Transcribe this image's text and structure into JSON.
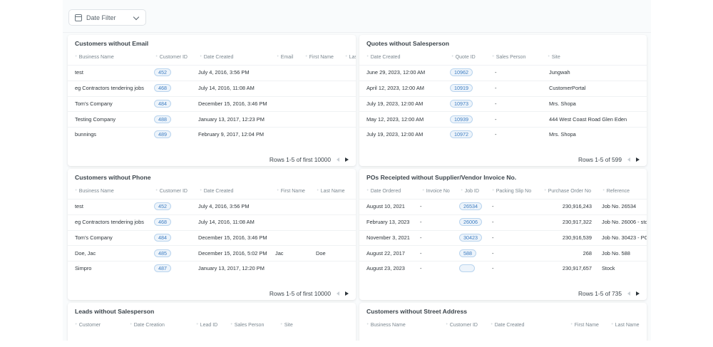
{
  "filter": {
    "label": "Date Filter"
  },
  "cards": {
    "c1": {
      "title": "Customers without Email",
      "headers": [
        "Business Name",
        "Customer ID",
        "Date Created",
        "Email",
        "First Name",
        "Las"
      ],
      "rows": [
        [
          "test",
          "452",
          "July 4, 2016, 3:56 PM",
          "",
          "",
          ""
        ],
        [
          "eg Contractors tendering jobs",
          "468",
          "July 14, 2016, 11:08 AM",
          "",
          "",
          ""
        ],
        [
          "Tom's Company",
          "484",
          "December 15, 2016, 3:46 PM",
          "",
          "",
          ""
        ],
        [
          "Testing Company",
          "488",
          "January 13, 2017, 12:23 PM",
          "",
          "",
          ""
        ],
        [
          "bunnings",
          "489",
          "February 9, 2017, 12:04 PM",
          "",
          "",
          ""
        ]
      ],
      "footer": "Rows 1-5 of first 10000"
    },
    "c2": {
      "title": "Quotes without Salesperson",
      "headers": [
        "Date Created",
        "Quote ID",
        "Sales Person",
        "Site"
      ],
      "rows": [
        [
          "June 29, 2023, 12:00 AM",
          "10962",
          "-",
          "Jungwah"
        ],
        [
          "April 12, 2023, 12:00 AM",
          "10919",
          "-",
          "CustomerPortal"
        ],
        [
          "July 19, 2023, 12:00 AM",
          "10973",
          "-",
          "Mrs. Shopa"
        ],
        [
          "May 12, 2023, 12:00 AM",
          "10939",
          "-",
          "444 West Coast Road Glen Eden"
        ],
        [
          "July 19, 2023, 12:00 AM",
          "10972",
          "-",
          "Mrs. Shopa"
        ]
      ],
      "footer": "Rows 1-5 of 599"
    },
    "c3": {
      "title": "Customers without Phone",
      "headers": [
        "Business Name",
        "Customer ID",
        "Date Created",
        "First Name",
        "Last Name"
      ],
      "rows": [
        [
          "test",
          "452",
          "July 4, 2016, 3:56 PM",
          "",
          ""
        ],
        [
          "eg Contractors tendering jobs",
          "468",
          "July 14, 2016, 11:08 AM",
          "",
          ""
        ],
        [
          "Tom's Company",
          "484",
          "December 15, 2016, 3:46 PM",
          "",
          ""
        ],
        [
          "Doe, Jac",
          "485",
          "December 15, 2016, 5:02 PM",
          "Jac",
          "Doe"
        ],
        [
          "Simpro",
          "487",
          "January 13, 2017, 12:20 PM",
          "",
          ""
        ]
      ],
      "footer": "Rows 1-5 of first 10000"
    },
    "c4": {
      "title": "POs Receipted without Supplier/Vendor Invoice No.",
      "headers": [
        "Date Ordered",
        "Invoice No",
        "Job ID",
        "Packing Slip No",
        "Purchase Order No",
        "Reference"
      ],
      "rows": [
        [
          "August 10, 2021",
          "-",
          "26534",
          "-",
          "230,916,243",
          "Job No. 26534"
        ],
        [
          "February 13, 2023",
          "-",
          "26006",
          "-",
          "230,917,322",
          "Job No. 26006 - sto"
        ],
        [
          "November 3, 2021",
          "-",
          "30423",
          "-",
          "230,916,539",
          "Job No. 30423 - PO"
        ],
        [
          "August 22, 2017",
          "-",
          "588",
          "-",
          "268",
          "Job No. 588"
        ],
        [
          "August 23, 2023",
          "-",
          "",
          "-",
          "230,917,657",
          "Stock"
        ]
      ],
      "footer": "Rows 1-5 of 735"
    },
    "c5": {
      "title": "Leads without Salesperson",
      "headers": [
        "Customer",
        "Date Creation",
        "Lead ID",
        "Sales Person",
        "Site"
      ]
    },
    "c6": {
      "title": "Customers without Street Address",
      "headers": [
        "Business Name",
        "Customer ID",
        "Date Created",
        "First Name",
        "Last Name"
      ]
    }
  }
}
